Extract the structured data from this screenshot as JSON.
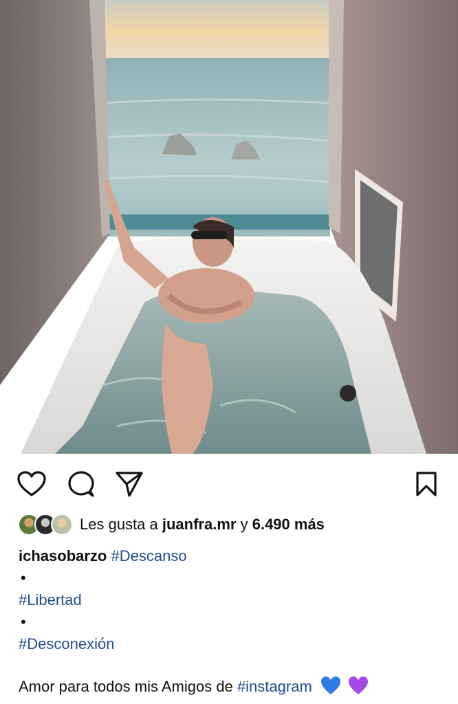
{
  "photo": {
    "subject": "woman in sunglasses relaxing in a bathtub by an open window overlooking the sea",
    "colors": {
      "sky_top": "#f6d6a3",
      "sky_bottom": "#e9ddc8",
      "sea": "#7fa7ad",
      "wall": "#8a7a78",
      "tub": "#efeeec",
      "water": "#8ea7a6"
    }
  },
  "actions": {
    "like": "heart-outline",
    "comment": "speech-bubble",
    "share": "paper-plane",
    "save": "bookmark"
  },
  "likes": {
    "prefix": "Les gusta a",
    "user": "juanfra.mr",
    "connector": "y",
    "count": "6.490 más"
  },
  "caption": {
    "username": "ichasobarzo",
    "tag1": "#Descanso",
    "sep1": "•",
    "tag2": "#Libertad",
    "sep2": "•",
    "tag3": "#Desconexión",
    "message": "Amor para todos mis Amigos de",
    "tag4": "#instagram",
    "emoji1": "blue-heart",
    "emoji2": "purple-heart"
  },
  "colors": {
    "hashtag": "#1f4e8c",
    "text": "#111111"
  }
}
